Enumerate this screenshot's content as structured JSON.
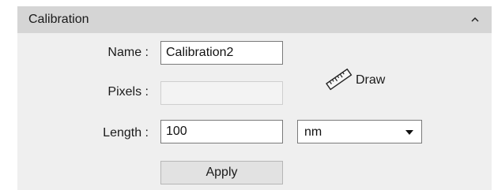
{
  "panel": {
    "title": "Calibration",
    "collapse_icon": "chevron-up-icon"
  },
  "form": {
    "name_label": "Name :",
    "name_value": "Calibration2",
    "pixels_label": "Pixels :",
    "pixels_value": "",
    "length_label": "Length :",
    "length_value": "100",
    "unit_selected": "nm",
    "unit_icon": "chevron-down-icon"
  },
  "draw": {
    "label": "Draw",
    "icon": "ruler-icon"
  },
  "apply": {
    "label": "Apply"
  }
}
